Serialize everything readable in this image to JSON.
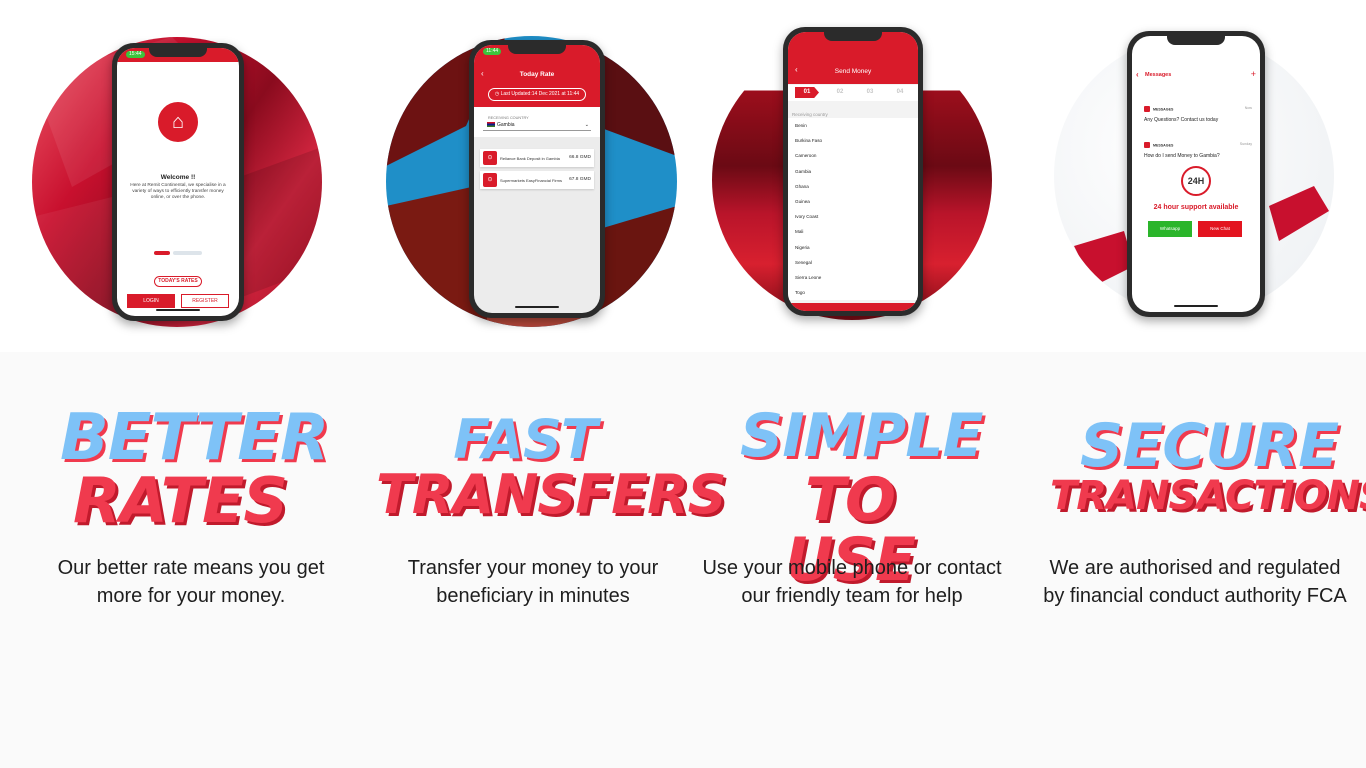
{
  "phones": {
    "welcome": {
      "time": "15:44",
      "title": "Welcome !!",
      "text": "Here at Remit Continental, we specialise in a variety of ways to efficiently transfer money online, or over the phone.",
      "rates_button": "TODAY'S RATES",
      "login_button": "LOGIN",
      "register_button": "REGISTER"
    },
    "today_rate": {
      "time": "11:44",
      "title": "Today Rate",
      "updated": "Last Updated:14 Dec 2021 at 11:44",
      "receiving_label": "RECEIVING COUNTRY",
      "country": "Gambia",
      "rows": [
        {
          "name": "Reliance Bank Deposit in Gambia",
          "value": "66.8 GMD"
        },
        {
          "name": "Supermarkets EasyFinancial Firms",
          "value": "67.8 GMD"
        }
      ]
    },
    "send_money": {
      "title": "Send Money",
      "steps": [
        "01",
        "02",
        "03",
        "04"
      ],
      "receiving_placeholder": "Receiving country",
      "countries": [
        "Benin",
        "Burkina Faso",
        "Cameroon",
        "Gambia",
        "Ghana",
        "Guinea",
        "Ivory Coast",
        "Mali",
        "Nigeria",
        "Senegal",
        "Sierra Leone",
        "Togo"
      ]
    },
    "messages": {
      "title": "Messages",
      "items": [
        {
          "tag": "MESSAGES",
          "date": "Now",
          "body": "Any Questions? Contact us today"
        },
        {
          "tag": "MESSAGES",
          "date": "Sunday",
          "body": "How do I send Money to Gambia?"
        }
      ],
      "clock_label": "24H",
      "support": "24 hour support available",
      "whatsapp_button": "Whatsapp",
      "new_chat_button": "New Chat"
    }
  },
  "features": [
    {
      "line1": "BETTER",
      "line2": "RATES",
      "desc1": "Our better rate means you get",
      "desc2": "more for your money."
    },
    {
      "line1": "FAST",
      "line2": "TRANSFERS",
      "desc1": "Transfer your money to your",
      "desc2": "beneficiary in minutes"
    },
    {
      "line1": "SIMPLE",
      "line2": "TO USE",
      "desc1": "Use your mobile phone or contact",
      "desc2": "our friendly team for help"
    },
    {
      "line1": "SECURE",
      "line2": "TRANSACTIONS",
      "desc1": "We are authorised and regulated",
      "desc2": "by financial conduct authority FCA"
    }
  ],
  "icons": [
    "home-icon",
    "back-arrow-icon",
    "calendar-icon",
    "chevron-down-icon",
    "plus-icon",
    "clock-24h-icon"
  ],
  "colors": {
    "brand_red": "#d91b2a",
    "headline_blue": "#7ec2f7",
    "headline_red": "#f03a4e",
    "whatsapp_green": "#2bb52b"
  }
}
